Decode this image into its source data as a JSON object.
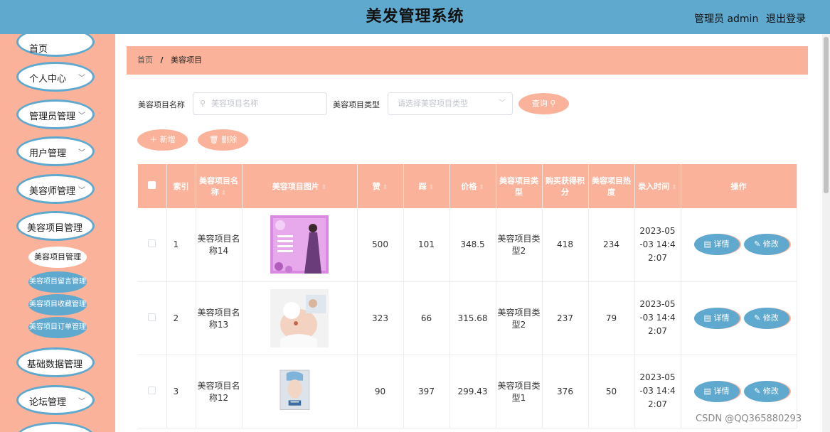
{
  "header": {
    "title": "美发管理系统",
    "user": "管理员 admin",
    "logout": "退出登录"
  },
  "sidebar": {
    "items": [
      {
        "label": "首页",
        "has_arrow": false
      },
      {
        "label": "个人中心",
        "has_arrow": true
      },
      {
        "label": "管理员管理",
        "has_arrow": true
      },
      {
        "label": "用户管理",
        "has_arrow": true
      },
      {
        "label": "美容师管理",
        "has_arrow": true
      },
      {
        "label": "美容项目管理",
        "has_arrow": false
      },
      {
        "label": "基础数据管理",
        "has_arrow": false
      },
      {
        "label": "论坛管理",
        "has_arrow": true
      }
    ],
    "subitems": [
      {
        "label": "美容项目管理",
        "active": true
      },
      {
        "label": "美容项目留言管理",
        "active": false
      },
      {
        "label": "美容项目收藏管理",
        "active": false
      },
      {
        "label": "美容项目订单管理",
        "active": false
      }
    ]
  },
  "breadcrumb": {
    "home": "首页",
    "separator": "/",
    "current": "美容项目"
  },
  "filters": {
    "name_label": "美容项目名称",
    "name_placeholder": "美容项目名称",
    "type_label": "美容项目类型",
    "type_placeholder": "请选择美容项目类型",
    "search_button": "查询"
  },
  "actions": {
    "add": "新增",
    "delete": "删除"
  },
  "table": {
    "headers": [
      "索引",
      "美容项目名称",
      "美容项目图片",
      "赞",
      "踩",
      "价格",
      "美容项目类型",
      "购买获得积分",
      "美容项目热度",
      "录入时间",
      "操作"
    ],
    "rows": [
      {
        "index": "1",
        "name": "美容项目名称14",
        "likes": "500",
        "dislikes": "101",
        "price": "348.5",
        "type": "美容项目类型2",
        "points": "418",
        "heat": "234",
        "time": "2023-05-03 14:42:07"
      },
      {
        "index": "2",
        "name": "美容项目名称13",
        "likes": "323",
        "dislikes": "66",
        "price": "315.68",
        "type": "美容项目类型2",
        "points": "237",
        "heat": "79",
        "time": "2023-05-03 14:42:07"
      },
      {
        "index": "3",
        "name": "美容项目名称12",
        "likes": "90",
        "dislikes": "397",
        "price": "299.43",
        "type": "美容项目类型1",
        "points": "376",
        "heat": "50",
        "time": "2023-05-03 14:42:07"
      }
    ],
    "detail_label": "详情",
    "edit_label": "修改"
  },
  "watermark": "CSDN @QQ365880293",
  "colors": {
    "header_bg": "#5fa9cf",
    "sidebar_bg": "#fbb29a",
    "accent": "#fbb29a"
  }
}
